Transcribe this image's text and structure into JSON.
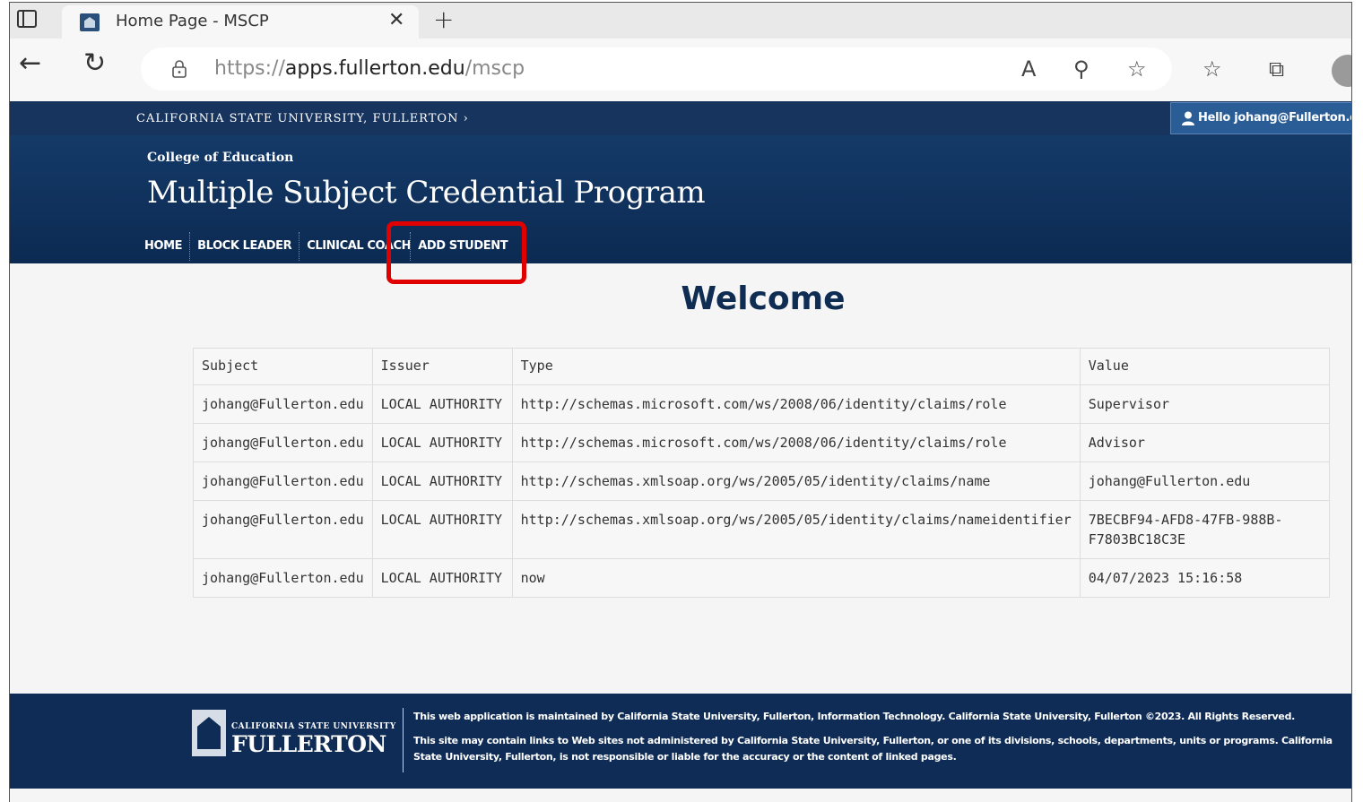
{
  "browser": {
    "tab_title": "Home Page - MSCP",
    "close_glyph": "✕",
    "new_tab_glyph": "+",
    "back_glyph": "←",
    "reload_glyph": "↻",
    "url_scheme": "https://",
    "url_host": "apps.fullerton.edu",
    "url_path": "/mscp",
    "read_aloud_glyph": "A",
    "zoom_glyph": "⚲",
    "favorite_glyph": "☆",
    "favorites_glyph": "☆",
    "collections_glyph": "⧉"
  },
  "site": {
    "university_link": "CALIFORNIA STATE UNIVERSITY, FULLERTON ›",
    "hello_user": "Hello johang@Fullerton.edu",
    "college": "College of Education",
    "program_title": "Multiple Subject Credential Program",
    "menu": [
      "HOME",
      "BLOCK LEADER",
      "CLINICAL COACH",
      "ADD STUDENT"
    ],
    "welcome": "Welcome"
  },
  "claims_table": {
    "headers": [
      "Subject",
      "Issuer",
      "Type",
      "Value"
    ],
    "rows": [
      [
        "johang@Fullerton.edu",
        "LOCAL AUTHORITY",
        "http://schemas.microsoft.com/ws/2008/06/identity/claims/role",
        "Supervisor"
      ],
      [
        "johang@Fullerton.edu",
        "LOCAL AUTHORITY",
        "http://schemas.microsoft.com/ws/2008/06/identity/claims/role",
        "Advisor"
      ],
      [
        "johang@Fullerton.edu",
        "LOCAL AUTHORITY",
        "http://schemas.xmlsoap.org/ws/2005/05/identity/claims/name",
        "johang@Fullerton.edu"
      ],
      [
        "johang@Fullerton.edu",
        "LOCAL AUTHORITY",
        "http://schemas.xmlsoap.org/ws/2005/05/identity/claims/nameidentifier",
        "7BECBF94-AFD8-47FB-988B-F7803BC18C3E"
      ],
      [
        "johang@Fullerton.edu",
        "LOCAL AUTHORITY",
        "now",
        "04/07/2023 15:16:58"
      ]
    ]
  },
  "footer": {
    "logo_small": "CALIFORNIA STATE UNIVERSITY",
    "logo_big": "FULLERTON",
    "maintained_text": "This web application is maintained by California State University, Fullerton, Information Technology. California State University, Fullerton ©2023. All Rights Reserved.",
    "disclaimer_text": "This site may contain links to Web sites not administered by California State University, Fullerton, or one of its divisions, schools, departments, units or programs. California State University, Fullerton, is not responsible or liable for the accuracy or the content of linked pages."
  },
  "colors": {
    "header_navy": "#0c2a52",
    "topbar_navy": "#17345e",
    "highlight_red": "#e00000",
    "welcome_navy": "#0f2d52"
  }
}
